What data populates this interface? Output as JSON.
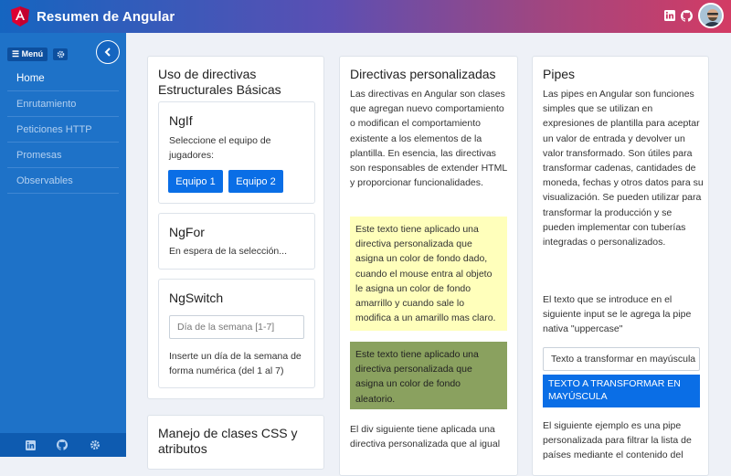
{
  "header": {
    "title": "Resumen de Angular"
  },
  "sidebar": {
    "menu_label": "Menú",
    "items": [
      {
        "label": "Home"
      },
      {
        "label": "Enrutamiento"
      },
      {
        "label": "Peticiones HTTP"
      },
      {
        "label": "Promesas"
      },
      {
        "label": "Observables"
      }
    ]
  },
  "col1": {
    "title": "Uso de directivas Estructurales Básicas",
    "ngif": {
      "title": "NgIf",
      "text": "Seleccione el equipo de jugadores:",
      "btn1": "Equipo 1",
      "btn2": "Equipo 2"
    },
    "ngfor": {
      "title": "NgFor",
      "text": "En espera de la selección..."
    },
    "ngswitch": {
      "title": "NgSwitch",
      "placeholder": "Día de la semana [1-7]",
      "text": "Inserte un día de la semana de forma numérica (del 1 al 7)"
    },
    "css_title": "Manejo de clases CSS y atributos"
  },
  "col2": {
    "title": "Directivas personalizadas",
    "intro": "Las directivas en Angular son clases que agregan nuevo comportamiento o modifican el comportamiento existente a los elementos de la plantilla. En esencia, las directivas son responsables de extender HTML y proporcionar funcionalidades.",
    "yellow_text": "Este texto tiene aplicado una directiva personalizada que asigna un color de fondo dado, cuando el mouse entra al objeto le asigna un color de fondo amarrillo y cuando sale lo modifica a un amarillo mas claro.",
    "olive_text": "Este texto tiene aplicado una directiva personalizada que asigna un color de fondo aleatorio.",
    "bottom_text": "El div siguiente tiene aplicada una directiva personalizada que al igual"
  },
  "col3": {
    "title": "Pipes",
    "intro": "Las pipes en Angular son funciones simples que se utilizan en expresiones de plantilla para aceptar un valor de entrada y devolver un valor transformado. Son útiles para transformar cadenas, cantidades de moneda, fechas y otros datos para su visualización. Se pueden utilizar para transformar la producción y se pueden implementar con tuberías integradas o personalizados.",
    "upper_intro": "El texto que se introduce en el siguiente input se le agrega la pipe nativa \"uppercase\"",
    "input_value": "Texto a transformar en mayúscula",
    "upper_output": "TEXTO A TRANSFORMAR EN MAYÚSCULA",
    "bottom_text": "El siguiente ejemplo es una pipe personalizada para filtrar la lista de países mediante el contenido del"
  },
  "colors": {
    "sidebar": "#1e72c8",
    "button": "#0a6ee6",
    "yellow": "#ffffbb",
    "olive": "#8aa15f"
  }
}
